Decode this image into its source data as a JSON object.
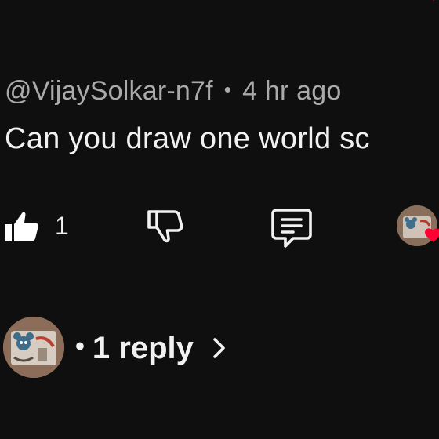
{
  "comment": {
    "handle": "@VijaySolkar-n7f",
    "separator": "•",
    "timestamp": "4 hr ago",
    "text": "Can you draw one world sc"
  },
  "actions": {
    "like_count": "1",
    "like_icon": "thumbs-up-filled-icon",
    "dislike_icon": "thumbs-down-icon",
    "reply_icon": "comment-icon",
    "heart_icon": "heart-icon"
  },
  "replies": {
    "dot": "•",
    "label": "1 reply",
    "chevron_icon": "chevron-right-icon"
  },
  "colors": {
    "background": "#0f0f0f",
    "primary_text": "#f1f1f1",
    "secondary_text": "#aaaaaa",
    "heart": "#ff0033"
  }
}
